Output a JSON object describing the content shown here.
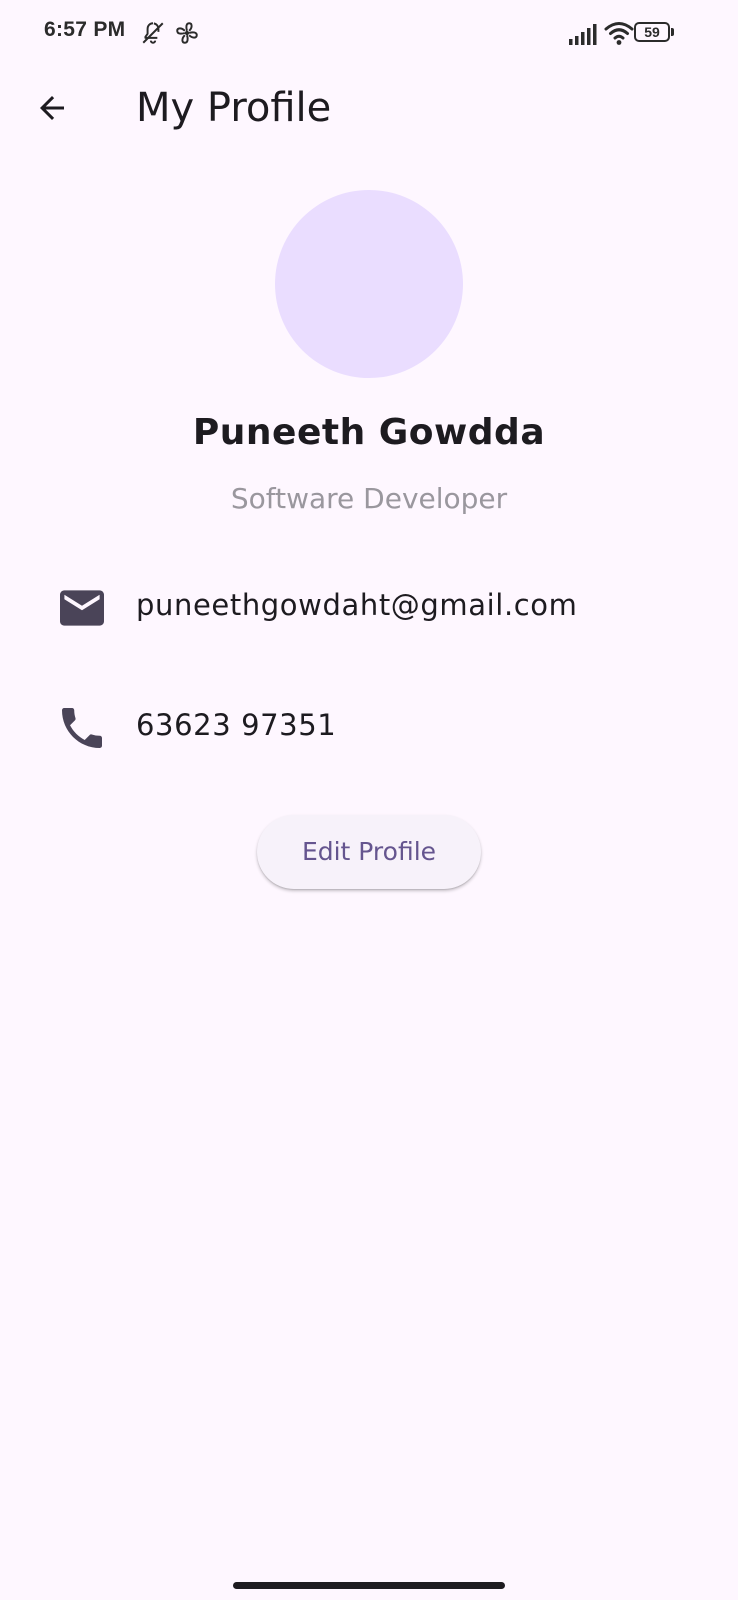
{
  "status_bar": {
    "time": "6:57 PM",
    "battery_level": "59",
    "icons": [
      "bell-off-icon",
      "fan-icon",
      "signal-icon",
      "wifi-icon",
      "battery-icon"
    ]
  },
  "app_bar": {
    "title": "My Profile",
    "back_icon": "arrow-back-icon"
  },
  "profile": {
    "name": "Puneeth Gowdda",
    "role": "Software Developer",
    "avatar_color": "#eaddff"
  },
  "contact": {
    "email": "puneethgowdaht@gmail.com",
    "email_icon": "mail-icon",
    "phone": "63623 97351",
    "phone_icon": "phone-icon"
  },
  "actions": {
    "edit_label": "Edit Profile"
  },
  "colors": {
    "background": "#fef7ff",
    "primary_text": "#1d1b20",
    "secondary_text": "#9a979e",
    "accent": "#65558f"
  }
}
